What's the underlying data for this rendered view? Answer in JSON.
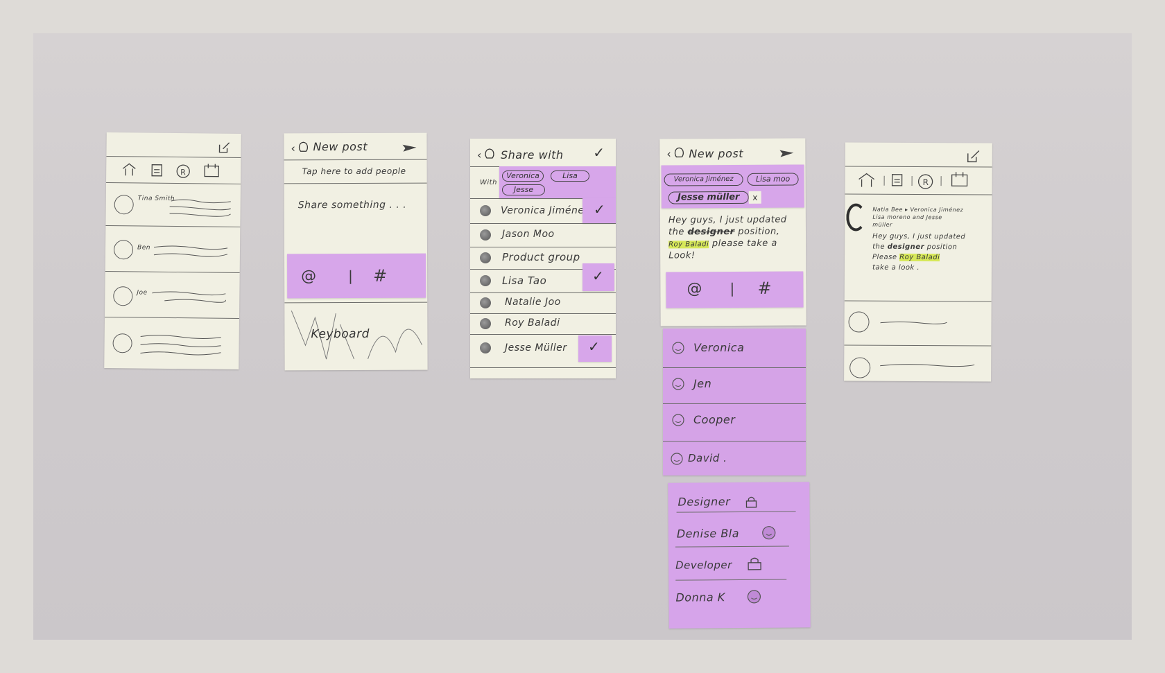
{
  "card1": {
    "rows": [
      "Tina Smith",
      "Ben",
      "Joe",
      ""
    ]
  },
  "card2": {
    "title": "New post",
    "hint": "Tap here to add people",
    "placeholder": "Share something . . .",
    "toolbar": [
      "@",
      "|",
      "#"
    ],
    "keyboard": "Keyboard"
  },
  "card3": {
    "title": "Share with",
    "with_label": "With",
    "chips": [
      "Veronica",
      "Lisa",
      "Jesse"
    ],
    "people": [
      {
        "name": "Veronica Jiménez",
        "checked": true
      },
      {
        "name": "Jason Moo",
        "checked": false
      },
      {
        "name": "Product group",
        "checked": false
      },
      {
        "name": "Lisa Tao",
        "checked": true
      },
      {
        "name": "Natalie Joo",
        "checked": false
      },
      {
        "name": "Roy Baladi",
        "checked": false
      },
      {
        "name": "Jesse Müller",
        "checked": true
      }
    ],
    "check": "✓"
  },
  "card4": {
    "title": "New post",
    "chips": [
      "Veronica Jiménez",
      "Lisa moo",
      "Jesse müller"
    ],
    "chip_close": "x",
    "message_1": "Hey guys, I just updated",
    "message_2a": "the ",
    "message_2b": "designer",
    "message_2c": " position,",
    "message_3a": "Roy Baladi",
    "message_3b": " please take a",
    "message_4": "Look!",
    "toolbar": [
      "@",
      "|",
      "#"
    ],
    "mentions": [
      "Veronica",
      "Jen",
      "Cooper",
      "David ."
    ],
    "tags": [
      {
        "label": "Designer",
        "icon": "lock-icon"
      },
      {
        "label": "Denise Bla",
        "icon": "smiley-icon"
      },
      {
        "label": "Developer",
        "icon": "lock-icon"
      },
      {
        "label": "Donna K",
        "icon": "smiley-icon"
      }
    ]
  },
  "card5": {
    "header_line1": "Natia Bee ▸ Veronica Jiménez",
    "header_line2": "Lisa moreno and Jesse",
    "header_line3": "müller",
    "body_1": "Hey guys, I just updated",
    "body_2a": "the ",
    "body_2b": "designer",
    "body_2c": " position",
    "body_3a": "Please ",
    "body_3b": "Roy Baladi",
    "body_4": "take a look ."
  }
}
